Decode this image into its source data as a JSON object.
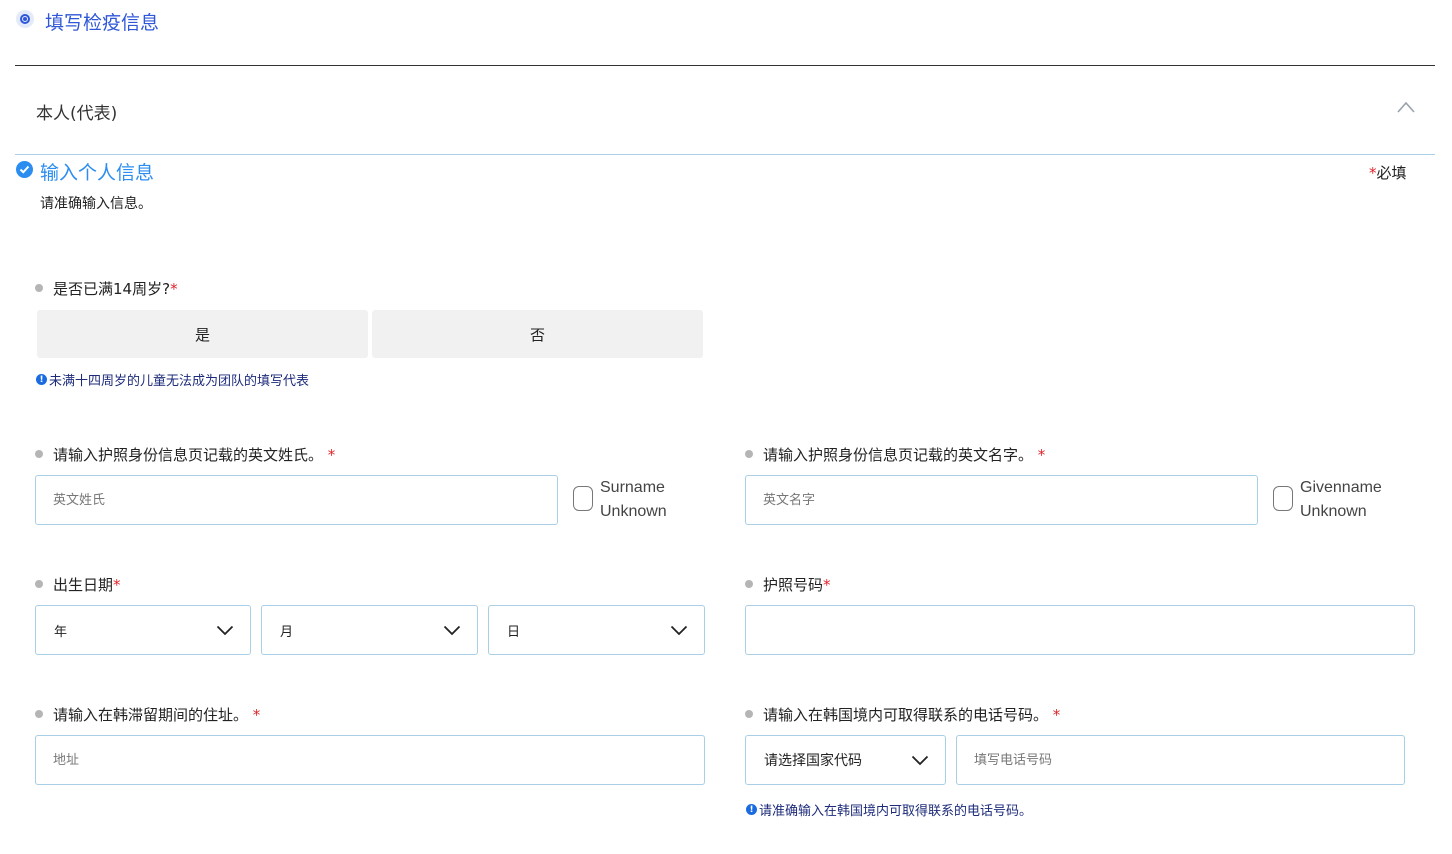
{
  "step": {
    "title": "填写检疫信息"
  },
  "accordion": {
    "title": "本人(代表)"
  },
  "section": {
    "title": "输入个人信息",
    "required_mark": "*",
    "required_text": "必填",
    "description": "请准确输入信息。"
  },
  "age_question": {
    "label": "是否已满14周岁?",
    "required_mark": "*",
    "options": [
      "是",
      "否"
    ],
    "info": "未满十四周岁的儿童无法成为团队的填写代表"
  },
  "surname": {
    "label": "请输入护照身份信息页记载的英文姓氏。",
    "required_mark": "*",
    "placeholder": "英文姓氏",
    "unknown_label_1": "Surname",
    "unknown_label_2": "Unknown"
  },
  "givenname": {
    "label": "请输入护照身份信息页记载的英文名字。",
    "required_mark": "*",
    "placeholder": "英文名字",
    "unknown_label_1": "Givenname",
    "unknown_label_2": "Unknown"
  },
  "birthdate": {
    "label": "出生日期",
    "required_mark": "*",
    "year": "年",
    "month": "月",
    "day": "日"
  },
  "passport": {
    "label": "护照号码",
    "required_mark": "*",
    "value": ""
  },
  "address": {
    "label": "请输入在韩滞留期间的住址。",
    "required_mark": "*",
    "placeholder": "地址"
  },
  "phone": {
    "label": "请输入在韩国境内可取得联系的电话号码。",
    "required_mark": "*",
    "country_code": "请选择国家代码",
    "placeholder": "填写电话号码",
    "info": "请准确输入在韩国境内可取得联系的电话号码。"
  },
  "icons": {
    "step": "radio-selected-icon",
    "accordion": "chevron-up-icon",
    "section": "check-circle-icon",
    "info": "info-icon",
    "dropdown": "chevron-down-icon"
  },
  "colors": {
    "primary_blue": "#2f57d8",
    "accent_blue": "#2b8df0",
    "required_red": "#e0242b",
    "field_border": "#a9cfe6",
    "choice_bg": "#f1f1f1"
  }
}
